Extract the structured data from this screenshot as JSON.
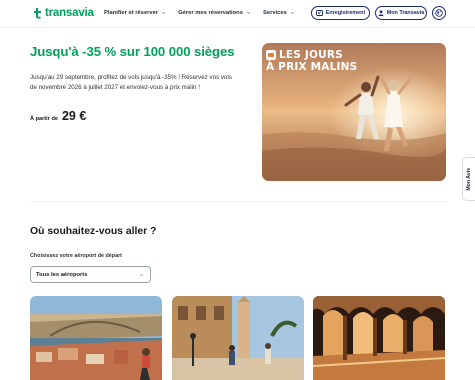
{
  "header": {
    "brand": "transavia",
    "nav": [
      {
        "label": "Planifier et réserver"
      },
      {
        "label": "Gérer mes réservations"
      },
      {
        "label": "Services"
      }
    ],
    "checkin_label": "Enregistrement",
    "account_label": "Mon Transavia"
  },
  "promo": {
    "title": "Jusqu'à -35 % sur 100 000 sièges",
    "description": "Jusqu'au 29 septembre, profitez de vols jusqu'à -35% ! Réservez vos vols de novembre 2026 à juillet 2027 et envolez-vous à prix malin !",
    "price_prefix": "À partir de",
    "price": "29 €",
    "badge_line1": "LES JOURS",
    "badge_line2": "À PRIX MALINS"
  },
  "side_tab": "Mon Avis",
  "destinations": {
    "title": "Où souhaitez-vous aller ?",
    "select_label": "Choisissez votre aéroport de départ",
    "select_value": "Tous les aéroports"
  },
  "colors": {
    "brand_green": "#00a15a",
    "navy": "#1b2d6e"
  }
}
